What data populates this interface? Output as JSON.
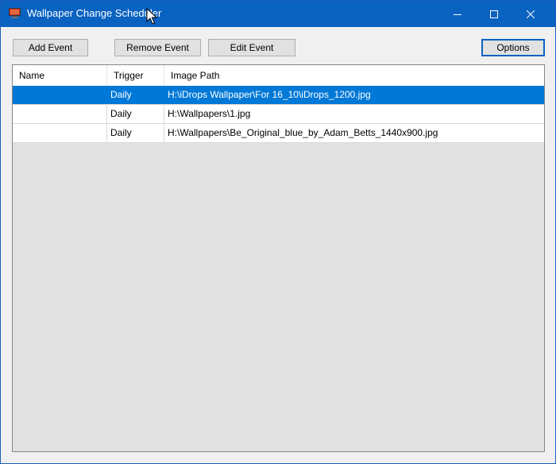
{
  "window": {
    "title": "Wallpaper Change Scheduler",
    "accent_color": "#0a62c1",
    "icons": {
      "app": "monitor-icon",
      "minimize": "minimize-icon",
      "maximize": "maximize-icon",
      "close": "close-icon"
    }
  },
  "toolbar": {
    "add_label": "Add Event",
    "remove_label": "Remove Event",
    "edit_label": "Edit Event",
    "options_label": "Options"
  },
  "list": {
    "columns": [
      "Name",
      "Trigger",
      "Image Path"
    ],
    "selection_color": "#0078d7",
    "rows": [
      {
        "name": "",
        "trigger": "Daily",
        "path": "H:\\iDrops Wallpaper\\For 16_10\\iDrops_1200.jpg",
        "selected": true
      },
      {
        "name": "",
        "trigger": "Daily",
        "path": "H:\\Wallpapers\\1.jpg",
        "selected": false
      },
      {
        "name": "",
        "trigger": "Daily",
        "path": "H:\\Wallpapers\\Be_Original_blue_by_Adam_Betts_1440x900.jpg",
        "selected": false
      }
    ]
  }
}
